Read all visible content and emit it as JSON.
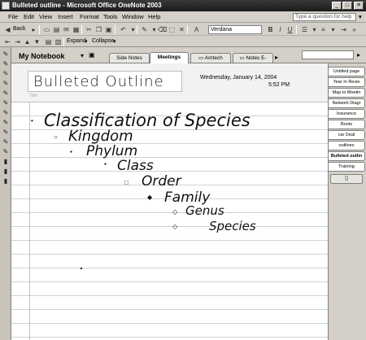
{
  "window": {
    "title": "Bulleted outline - Microsoft Office OneNote 2003",
    "help_placeholder": "Type a question for help",
    "min_glyph": "_",
    "max_glyph": "□",
    "close_glyph": "✕"
  },
  "menu": [
    "File",
    "Edit",
    "View",
    "Insert",
    "Format",
    "Tools",
    "Window",
    "Help"
  ],
  "toolbar": {
    "back_label": "Back",
    "font_name": "Verdana",
    "bold": "B",
    "italic": "I",
    "underline": "U",
    "expand_label": "Expand",
    "collapse_label": "Collapse"
  },
  "notebook": {
    "title": "My Notebook",
    "sections": [
      "Side Notes",
      "Meetings",
      "Amtech",
      "Notes E-"
    ],
    "active_section": "Meetings"
  },
  "page": {
    "title": "Bulleted Outline",
    "title_placeholder": "Title",
    "date": "Wednesday, January 14, 2004",
    "time": "5:52 PM"
  },
  "outline": [
    {
      "text": "Classification of Species",
      "level": 0,
      "bullet": "•"
    },
    {
      "text": "Kingdom",
      "level": 1,
      "bullet": "○"
    },
    {
      "text": "Phylum",
      "level": 2,
      "bullet": "▪"
    },
    {
      "text": "Class",
      "level": 3,
      "bullet": "▪"
    },
    {
      "text": "Order",
      "level": 4,
      "bullet": "□"
    },
    {
      "text": "Family",
      "level": 5,
      "bullet": "◆"
    },
    {
      "text": "Genus",
      "level": 6,
      "bullet": "◇"
    },
    {
      "text": "Species",
      "level": 7,
      "bullet": "◇"
    }
  ],
  "pages": [
    "Untitled page",
    "Year In Revie",
    "Map to Meetin",
    "Network Diagr",
    "Insurance",
    "Boots",
    "car Deal",
    "outlines",
    "Bulleted outlin",
    "Training"
  ],
  "active_page": "Bulleted outlin"
}
